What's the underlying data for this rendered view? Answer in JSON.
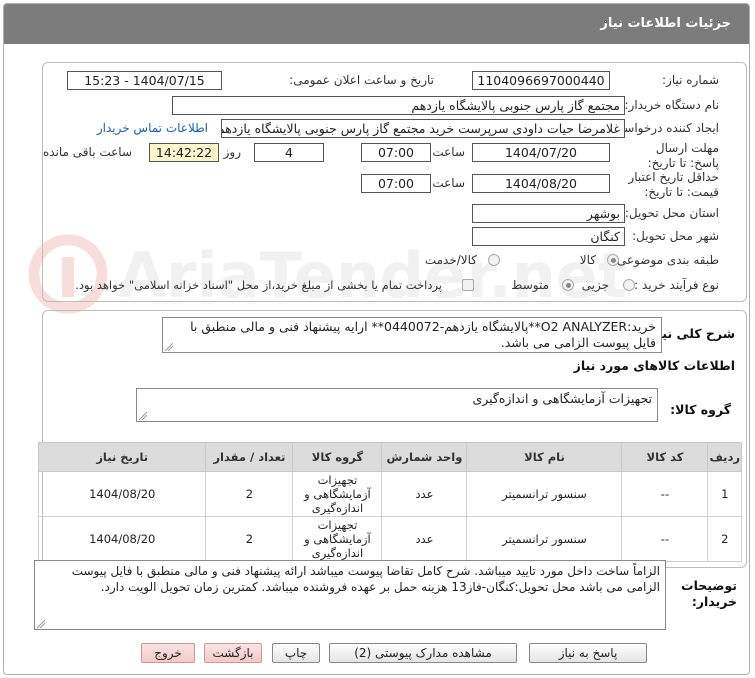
{
  "header": {
    "title": "جزئیات اطلاعات نیاز"
  },
  "form": {
    "need_number": {
      "label": "شماره نیاز:",
      "value": "1104096697000440"
    },
    "announce_date": {
      "label": "تاریخ و ساعت اعلان عمومی:",
      "value": "1404/07/15 - 15:23"
    },
    "buyer_org": {
      "label": "نام دستگاه خریدار:",
      "value": "مجتمع گاز پارس جنوبی  پالایشگاه یازدهم"
    },
    "requester": {
      "label": "ایجاد کننده درخواست:",
      "value": "غلامرضا حیات داودی سرپرست خرید مجتمع گاز پارس جنوبی  پالایشگاه یازدهم",
      "contact_link": "اطلاعات تماس خریدار"
    },
    "reply_deadline": {
      "label": "مهلت ارسال پاسخ: تا تاریخ:",
      "date": "1404/07/20",
      "time_label": "ساعت",
      "time": "07:00",
      "days": "4",
      "days_label": "روز و",
      "remaining": "14:42:22",
      "remaining_label": "ساعت باقی مانده"
    },
    "price_validity": {
      "label": "حداقل تاریخ اعتبار قیمت: تا تاریخ:",
      "date": "1404/08/20",
      "time_label": "ساعت",
      "time": "07:00"
    },
    "province": {
      "label": "استان محل تحویل:",
      "value": "بوشهر"
    },
    "city": {
      "label": "شهر محل تحویل:",
      "value": "کنگان"
    },
    "category": {
      "label": "طبقه بندی موضوعی:",
      "options": [
        "کالا",
        "کالا/خدمت"
      ]
    },
    "process_type": {
      "label": "نوع فرآیند خرید :",
      "options": [
        "جزیی",
        "متوسط"
      ],
      "treasury_note": "پرداخت تمام یا بخشی از مبلغ خرید،از محل \"اسناد خزانه اسلامی\" خواهد بود."
    }
  },
  "general_description": {
    "label": "شرح کلی نیاز:",
    "text": "خرید:O2 ANALYZER**پالایشگاه یازدهم-0440072** ارایه پیشنهاد فنی و مالی منطبق با فایل پیوست الزامی می باشد."
  },
  "goods_info": {
    "title": "اطلاعات کالاهای مورد نیاز",
    "group_label": "گروه کالا:",
    "group_value": "تجهیزات آزمایشگاهی و اندازه‌گیری"
  },
  "table": {
    "headers": [
      "ردیف",
      "کد کالا",
      "نام کالا",
      "واحد شمارش",
      "گروه کالا",
      "تعداد / مقدار",
      "تاریخ نیاز"
    ],
    "rows": [
      [
        "1",
        "--",
        "سنسور ترانسمیتر",
        "عدد",
        "تجهیزات آزمایشگاهی و اندازه‌گیری",
        "2",
        "1404/08/20"
      ],
      [
        "2",
        "--",
        "سنسور ترانسمیتر",
        "عدد",
        "تجهیزات آزمایشگاهی و اندازه‌گیری",
        "2",
        "1404/08/20"
      ]
    ]
  },
  "buyer_notes": {
    "label": "توضیحات خریدار:",
    "text": "الزاماً ساخت داخل مورد تایید میباشد. شرح کامل تقاضا پیوست میباشد ارائه پیشنهاد فنی و مالی منطبق با فایل پیوست الزامی می باشد محل تحویل:کنگان-فاز13 هزینه حمل بر عهده فروشنده میباشد. کمترین زمان تحویل الویت دارد."
  },
  "buttons": {
    "reply": "پاسخ به نیاز",
    "attachments": "مشاهده مدارک پیوستی (2)",
    "print": "چاپ",
    "back": "بازگشت",
    "exit": "خروج"
  },
  "watermark": {
    "text": "AriaTender.net"
  }
}
